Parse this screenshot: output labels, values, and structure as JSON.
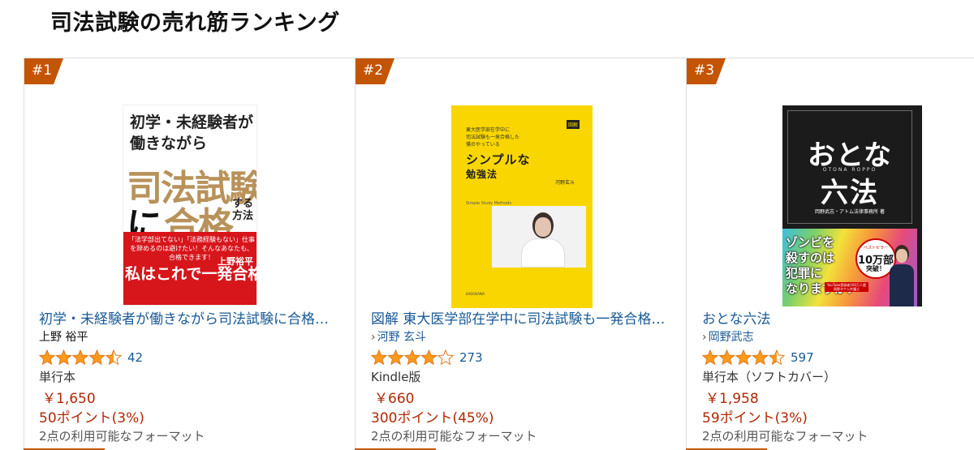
{
  "page_title": "司法試験の売れ筋ランキング",
  "colors": {
    "badge": "#c45500",
    "link": "#1a5a96",
    "price": "#b12704",
    "star": "#ff9a1a"
  },
  "items": [
    {
      "rank": "#1",
      "title": "初学・未経験者が働きながら司法試験に合格…",
      "author": "上野 裕平",
      "author_is_link": false,
      "rating": 4.5,
      "review_count": "42",
      "format": "単行本",
      "price": "￥1,650",
      "points": "50ポイント(3%)",
      "formats_available": "2点の利用可能なフォーマット",
      "cover": {
        "line1": "初学・未経験者が",
        "line2": "働きながら",
        "line3": "司法試験",
        "line4a": "に",
        "line4b": "合格",
        "line4c": "する方法",
        "red_small": "「法学部出てない」「法務経験もない」仕事を辞めるのは避けたい！そんなあなたも、合格できます！",
        "red_big": "私はこれで一発合格しました",
        "red_author": "上野裕平"
      }
    },
    {
      "rank": "#2",
      "title": "図解 東大医学部在学中に司法試験も一発合格…",
      "author": "河野 玄斗",
      "author_is_link": true,
      "rating": 4.0,
      "review_count": "273",
      "format": "Kindle版",
      "price": "￥660",
      "points": "300ポイント(45%)",
      "formats_available": "2点の利用可能なフォーマット",
      "cover": {
        "top_small": "東大医学部在学中に\n司法試験も一発合格した\n僕のやっている",
        "tag": "図解",
        "simple": "シンプルな",
        "benkyo": "勉強法",
        "author_small": "河野玄斗",
        "english": "Simple Study Methods",
        "publisher": "KADOKAWA"
      }
    },
    {
      "rank": "#3",
      "title": "おとな六法",
      "author": "岡野武志",
      "author_is_link": true,
      "rating": 4.5,
      "review_count": "597",
      "format": "単行本（ソフトカバー）",
      "price": "￥1,958",
      "points": "59ポイント(3%)",
      "formats_available": "2点の利用可能なフォーマット",
      "cover": {
        "otona": "おとな",
        "roppo": "六法",
        "roman": "OTONA ROPPO",
        "authors": "岡野武志・アトム法律事務所 著",
        "zombie": "ゾンビを\n殺すのは\n犯罪に\nなりますか？",
        "seller_small": "ベストセラー",
        "seller_big": "10万部",
        "seller_end": "突破！",
        "youtube": "YouTube登録者160万人超 岡野タケシ弁護士"
      }
    }
  ]
}
